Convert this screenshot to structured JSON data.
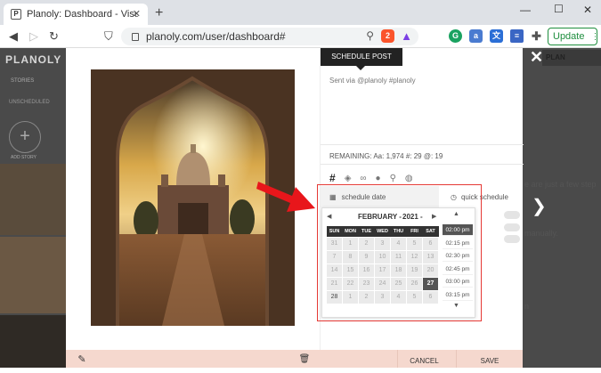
{
  "browser": {
    "tab_title": "Planoly: Dashboard - Visual planning",
    "tab_favicon": "P",
    "url": "planoly.com/user/dashboard#",
    "update_label": "Update",
    "brave_badge": "2"
  },
  "background": {
    "logo": "PLANOLY",
    "stories_label": "STORIES",
    "unscheduled_label": "UNSCHEDULED",
    "add_story_label": "ADD STORY",
    "plan_label": "PLAN",
    "text_fragment_1": "e are just a few step",
    "text_fragment_2": "manually.",
    "text_fragment_3": "n"
  },
  "modal": {
    "schedule_tab": "SCHEDULE POST",
    "caption": "Sent via @planoly #planoly",
    "remaining": "REMAINING: Aa: 1,974  #: 29  @: 19",
    "schedule_date_label": "schedule date",
    "quick_schedule_label": "quick schedule",
    "cancel_label": "CANCEL",
    "save_label": "SAVE"
  },
  "calendar": {
    "month_label": "FEBRUARY -",
    "year_label": "2021 -",
    "weekdays": [
      "SUN",
      "MON",
      "TUE",
      "WED",
      "THU",
      "FRI",
      "SAT"
    ],
    "weeks": [
      [
        "31",
        "1",
        "2",
        "3",
        "4",
        "5",
        "6"
      ],
      [
        "7",
        "8",
        "9",
        "10",
        "11",
        "12",
        "13"
      ],
      [
        "14",
        "15",
        "16",
        "17",
        "18",
        "19",
        "20"
      ],
      [
        "21",
        "22",
        "23",
        "24",
        "25",
        "26",
        "27"
      ],
      [
        "28",
        "1",
        "2",
        "3",
        "4",
        "5",
        "6"
      ]
    ],
    "selected_day": "27",
    "times": [
      "02:00 pm",
      "02:15 pm",
      "02:30 pm",
      "02:45 pm",
      "03:00 pm",
      "03:15 pm"
    ],
    "selected_time": "02:00 pm"
  },
  "colors": {
    "highlight": "#e53935",
    "footer": "#f5d8ce",
    "update_green": "#1e8e3e"
  }
}
